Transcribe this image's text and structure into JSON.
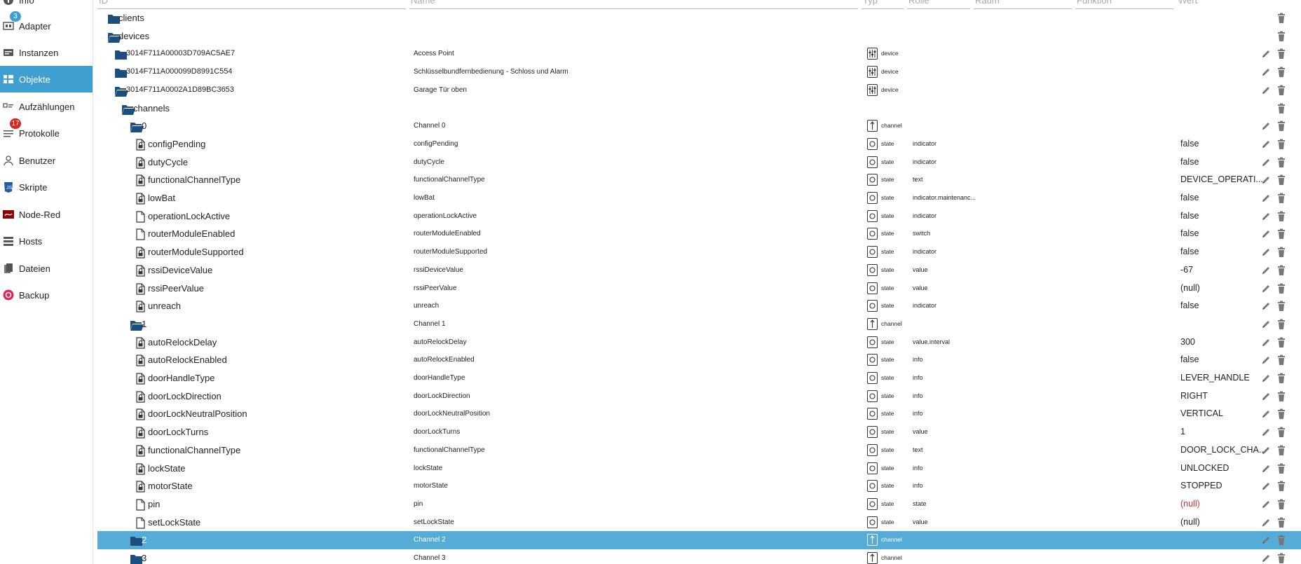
{
  "sidebar": {
    "items": [
      {
        "label": "Info",
        "icon": "info-icon",
        "badge": "",
        "active": false
      },
      {
        "label": "Adapter",
        "icon": "adapter-icon",
        "badge": "3",
        "badge_color": "#3e9fd0",
        "active": false
      },
      {
        "label": "Instanzen",
        "icon": "instances-icon",
        "badge": "",
        "active": false
      },
      {
        "label": "Objekte",
        "icon": "objects-icon",
        "badge": "",
        "active": true
      },
      {
        "label": "Aufzählungen",
        "icon": "enums-icon",
        "badge": "",
        "active": false
      },
      {
        "label": "Protokolle",
        "icon": "logs-icon",
        "badge": "17",
        "badge_color": "#d9261c",
        "active": false
      },
      {
        "label": "Benutzer",
        "icon": "user-icon",
        "badge": "",
        "active": false
      },
      {
        "label": "Skripte",
        "icon": "scripts-icon",
        "badge": "",
        "active": false
      },
      {
        "label": "Node-Red",
        "icon": "node-red-icon",
        "badge": "",
        "active": false
      },
      {
        "label": "Hosts",
        "icon": "hosts-icon",
        "badge": "",
        "active": false
      },
      {
        "label": "Dateien",
        "icon": "files-icon",
        "badge": "",
        "active": false
      },
      {
        "label": "Backup",
        "icon": "backup-icon",
        "badge": "",
        "active": false
      }
    ]
  },
  "table": {
    "headers": {
      "id": "ID",
      "name": "Name",
      "type": "Typ",
      "role": "Rolle",
      "room": "Raum",
      "function": "Funktion",
      "value": "Wert"
    },
    "rows": [
      {
        "kind": "folder",
        "open": false,
        "id": "clients",
        "name": "",
        "type": "",
        "role": "",
        "value": "",
        "edit": false
      },
      {
        "kind": "folder",
        "open": true,
        "id": "devices",
        "name": "",
        "type": "",
        "role": "",
        "value": "",
        "edit": false
      },
      {
        "kind": "folder",
        "open": false,
        "id": "3014F711A00003D709AC5AE7",
        "name": "Access Point",
        "type": "device",
        "role": "",
        "value": "",
        "edit": true
      },
      {
        "kind": "folder",
        "open": false,
        "id": "3014F711A000099D8991C554",
        "name": "Schlüsselbundfernbedienung - Schloss und Alarm",
        "type": "device",
        "role": "",
        "value": "",
        "edit": true
      },
      {
        "kind": "folder",
        "open": true,
        "id": "3014F711A0002A1D89BC3653",
        "name": "Garage Tür oben",
        "type": "device",
        "role": "",
        "value": "",
        "edit": true
      },
      {
        "kind": "folder",
        "open": true,
        "id": "channels",
        "name": "",
        "type": "",
        "role": "",
        "value": "",
        "edit": false
      },
      {
        "kind": "folder",
        "open": true,
        "id": "0",
        "name": "Channel 0",
        "type": "channel",
        "role": "",
        "value": "",
        "edit": true
      },
      {
        "kind": "state",
        "locked": true,
        "id": "configPending",
        "name": "configPending",
        "type": "state",
        "role": "indicator",
        "value": "false",
        "edit": true
      },
      {
        "kind": "state",
        "locked": true,
        "id": "dutyCycle",
        "name": "dutyCycle",
        "type": "state",
        "role": "indicator",
        "value": "false",
        "edit": true
      },
      {
        "kind": "state",
        "locked": true,
        "id": "functionalChannelType",
        "name": "functionalChannelType",
        "type": "state",
        "role": "text",
        "value": "DEVICE_OPERATI...",
        "edit": true
      },
      {
        "kind": "state",
        "locked": true,
        "id": "lowBat",
        "name": "lowBat",
        "type": "state",
        "role": "indicator.maintenanc...",
        "value": "false",
        "edit": true
      },
      {
        "kind": "state",
        "locked": false,
        "id": "operationLockActive",
        "name": "operationLockActive",
        "type": "state",
        "role": "indicator",
        "value": "false",
        "edit": true
      },
      {
        "kind": "state",
        "locked": false,
        "id": "routerModuleEnabled",
        "name": "routerModuleEnabled",
        "type": "state",
        "role": "switch",
        "value": "false",
        "edit": true
      },
      {
        "kind": "state",
        "locked": true,
        "id": "routerModuleSupported",
        "name": "routerModuleSupported",
        "type": "state",
        "role": "indicator",
        "value": "false",
        "edit": true
      },
      {
        "kind": "state",
        "locked": true,
        "id": "rssiDeviceValue",
        "name": "rssiDeviceValue",
        "type": "state",
        "role": "value",
        "value": "-67",
        "edit": true
      },
      {
        "kind": "state",
        "locked": true,
        "id": "rssiPeerValue",
        "name": "rssiPeerValue",
        "type": "state",
        "role": "value",
        "value": "(null)",
        "edit": true
      },
      {
        "kind": "state",
        "locked": true,
        "id": "unreach",
        "name": "unreach",
        "type": "state",
        "role": "indicator",
        "value": "false",
        "edit": true
      },
      {
        "kind": "folder",
        "open": true,
        "id": "1",
        "name": "Channel 1",
        "type": "channel",
        "role": "",
        "value": "",
        "edit": true
      },
      {
        "kind": "state",
        "locked": true,
        "id": "autoRelockDelay",
        "name": "autoRelockDelay",
        "type": "state",
        "role": "value.interval",
        "value": "300",
        "edit": true
      },
      {
        "kind": "state",
        "locked": true,
        "id": "autoRelockEnabled",
        "name": "autoRelockEnabled",
        "type": "state",
        "role": "info",
        "value": "false",
        "edit": true
      },
      {
        "kind": "state",
        "locked": true,
        "id": "doorHandleType",
        "name": "doorHandleType",
        "type": "state",
        "role": "info",
        "value": "LEVER_HANDLE",
        "edit": true
      },
      {
        "kind": "state",
        "locked": true,
        "id": "doorLockDirection",
        "name": "doorLockDirection",
        "type": "state",
        "role": "info",
        "value": "RIGHT",
        "edit": true
      },
      {
        "kind": "state",
        "locked": true,
        "id": "doorLockNeutralPosition",
        "name": "doorLockNeutralPosition",
        "type": "state",
        "role": "info",
        "value": "VERTICAL",
        "edit": true
      },
      {
        "kind": "state",
        "locked": true,
        "id": "doorLockTurns",
        "name": "doorLockTurns",
        "type": "state",
        "role": "value",
        "value": "1",
        "edit": true
      },
      {
        "kind": "state",
        "locked": true,
        "id": "functionalChannelType",
        "name": "functionalChannelType",
        "type": "state",
        "role": "text",
        "value": "DOOR_LOCK_CHA...",
        "edit": true
      },
      {
        "kind": "state",
        "locked": true,
        "id": "lockState",
        "name": "lockState",
        "type": "state",
        "role": "info",
        "value": "UNLOCKED",
        "edit": true
      },
      {
        "kind": "state",
        "locked": true,
        "id": "motorState",
        "name": "motorState",
        "type": "state",
        "role": "info",
        "value": "STOPPED",
        "edit": true
      },
      {
        "kind": "state",
        "locked": false,
        "id": "pin",
        "name": "pin",
        "type": "state",
        "role": "state",
        "value": "(null)",
        "value_red": true,
        "edit": true
      },
      {
        "kind": "state",
        "locked": false,
        "id": "setLockState",
        "name": "setLockState",
        "type": "state",
        "role": "value",
        "value": "(null)",
        "edit": true
      },
      {
        "kind": "folder",
        "open": false,
        "id": "2",
        "name": "Channel 2",
        "type": "channel",
        "role": "",
        "value": "",
        "edit": true,
        "selected": true
      },
      {
        "kind": "folder",
        "open": false,
        "id": "3",
        "name": "Channel 3",
        "type": "channel",
        "role": "",
        "value": "",
        "edit": true
      }
    ]
  },
  "colors": {
    "accent": "#3e9fd0",
    "selected_row": "#55acd6",
    "folder": "#1c4f80",
    "null_red": "#d42e2e"
  }
}
